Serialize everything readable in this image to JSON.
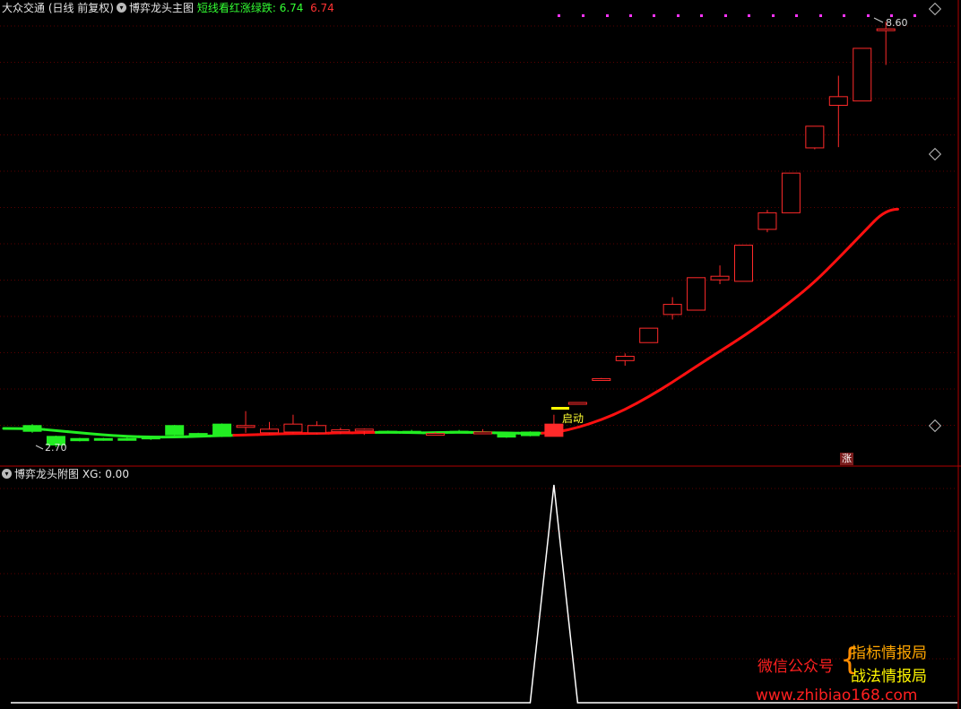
{
  "header": {
    "stock": "大众交通 (日线 前复权)",
    "indicator": "博弈龙头主图",
    "legend_label": "短线看红涨绿跌:",
    "legend_val1": "6.74",
    "legend_val2": "6.74"
  },
  "subheader": {
    "indicator": "博弈龙头附图",
    "xg_label": "XG:",
    "xg_value": "0.00"
  },
  "annotations": {
    "start_label": "启动",
    "high_label": "8.60",
    "low_label": "2.70",
    "zhang": "涨"
  },
  "watermark": {
    "public": "微信公众号",
    "brace": "{",
    "line1": "指标情报局",
    "line2": "战法情报局",
    "url": "www.zhibiao168.com"
  },
  "colors": {
    "bg": "#000000",
    "up": "#ff2a2a",
    "down": "#22ee22",
    "ma_red": "#ff1010",
    "ma_green": "#22ee22",
    "grid": "#5a0000",
    "xg_line": "#ffffff",
    "marker": "#ffff00",
    "dot": "#ff33ff"
  },
  "chart_data": [
    {
      "type": "candlestick",
      "title": "博弈龙头主图",
      "ylim": [
        2.5,
        8.9
      ],
      "series": [
        {
          "o": 3.0,
          "h": 3.02,
          "l": 2.9,
          "c": 2.92,
          "color": "down"
        },
        {
          "o": 2.85,
          "h": 2.86,
          "l": 2.7,
          "c": 2.73,
          "color": "down"
        },
        {
          "o": 2.82,
          "h": 2.83,
          "l": 2.78,
          "c": 2.79,
          "color": "down"
        },
        {
          "o": 2.81,
          "h": 2.83,
          "l": 2.79,
          "c": 2.82,
          "color": "down"
        },
        {
          "o": 2.82,
          "h": 2.84,
          "l": 2.79,
          "c": 2.8,
          "color": "down"
        },
        {
          "o": 2.83,
          "h": 2.85,
          "l": 2.8,
          "c": 2.84,
          "color": "down"
        },
        {
          "o": 3.0,
          "h": 3.01,
          "l": 2.86,
          "c": 2.87,
          "color": "down"
        },
        {
          "o": 2.88,
          "h": 2.9,
          "l": 2.86,
          "c": 2.89,
          "color": "down"
        },
        {
          "o": 3.02,
          "h": 3.03,
          "l": 2.84,
          "c": 2.85,
          "color": "down"
        },
        {
          "o": 2.98,
          "h": 3.2,
          "l": 2.9,
          "c": 3.0,
          "color": "up"
        },
        {
          "o": 2.9,
          "h": 3.05,
          "l": 2.88,
          "c": 2.95,
          "color": "up"
        },
        {
          "o": 2.91,
          "h": 3.15,
          "l": 2.89,
          "c": 3.02,
          "color": "up"
        },
        {
          "o": 2.9,
          "h": 3.06,
          "l": 2.88,
          "c": 3.0,
          "color": "up"
        },
        {
          "o": 2.94,
          "h": 2.97,
          "l": 2.88,
          "c": 2.92,
          "color": "up"
        },
        {
          "o": 2.93,
          "h": 2.96,
          "l": 2.87,
          "c": 2.95,
          "color": "up"
        },
        {
          "o": 2.91,
          "h": 2.93,
          "l": 2.9,
          "c": 2.92,
          "color": "down"
        },
        {
          "o": 2.92,
          "h": 2.94,
          "l": 2.9,
          "c": 2.91,
          "color": "down"
        },
        {
          "o": 2.88,
          "h": 2.91,
          "l": 2.87,
          "c": 2.89,
          "color": "up"
        },
        {
          "o": 2.92,
          "h": 2.94,
          "l": 2.9,
          "c": 2.91,
          "color": "down"
        },
        {
          "o": 2.9,
          "h": 2.95,
          "l": 2.89,
          "c": 2.91,
          "color": "up"
        },
        {
          "o": 2.89,
          "h": 2.91,
          "l": 2.83,
          "c": 2.84,
          "color": "down"
        },
        {
          "o": 2.91,
          "h": 2.92,
          "l": 2.85,
          "c": 2.86,
          "color": "down"
        },
        {
          "o": 2.85,
          "h": 3.15,
          "l": 2.85,
          "c": 3.02,
          "color": "up"
        },
        {
          "o": 3.32,
          "h": 3.32,
          "l": 3.32,
          "c": 3.32,
          "color": "up"
        },
        {
          "o": 3.65,
          "h": 3.66,
          "l": 3.65,
          "c": 3.65,
          "color": "up"
        },
        {
          "o": 3.9,
          "h": 4.0,
          "l": 3.83,
          "c": 3.96,
          "color": "up"
        },
        {
          "o": 4.15,
          "h": 4.35,
          "l": 4.15,
          "c": 4.35,
          "color": "up"
        },
        {
          "o": 4.54,
          "h": 4.78,
          "l": 4.47,
          "c": 4.68,
          "color": "up"
        },
        {
          "o": 4.6,
          "h": 5.05,
          "l": 4.6,
          "c": 5.05,
          "color": "up"
        },
        {
          "o": 5.02,
          "h": 5.22,
          "l": 4.96,
          "c": 5.07,
          "color": "up"
        },
        {
          "o": 5.0,
          "h": 5.5,
          "l": 5.0,
          "c": 5.5,
          "color": "up"
        },
        {
          "o": 5.72,
          "h": 5.99,
          "l": 5.68,
          "c": 5.95,
          "color": "up"
        },
        {
          "o": 5.95,
          "h": 6.5,
          "l": 5.95,
          "c": 6.5,
          "color": "up"
        },
        {
          "o": 6.85,
          "h": 7.15,
          "l": 6.83,
          "c": 7.15,
          "color": "up"
        },
        {
          "o": 7.44,
          "h": 7.85,
          "l": 6.86,
          "c": 7.56,
          "color": "up"
        },
        {
          "o": 7.5,
          "h": 8.23,
          "l": 7.5,
          "c": 8.23,
          "color": "up"
        },
        {
          "o": 8.5,
          "h": 8.6,
          "l": 8.0,
          "c": 8.5,
          "color": "up"
        }
      ],
      "ma": [
        2.96,
        2.93,
        2.9,
        2.87,
        2.85,
        2.84,
        2.84,
        2.85,
        2.86,
        2.87,
        2.88,
        2.89,
        2.89,
        2.9,
        2.9,
        2.91,
        2.9,
        2.9,
        2.91,
        2.9,
        2.9,
        2.89,
        2.9,
        2.97,
        3.08,
        3.22,
        3.4,
        3.6,
        3.82,
        4.03,
        4.24,
        4.47,
        4.72,
        4.99,
        5.32,
        5.66,
        6.0
      ],
      "ma_color": [
        "down",
        "down",
        "down",
        "down",
        "down",
        "down",
        "down",
        "down",
        "down",
        "up",
        "up",
        "up",
        "up",
        "up",
        "up",
        "down",
        "down",
        "down",
        "down",
        "down",
        "down",
        "down",
        "up",
        "up",
        "up",
        "up",
        "up",
        "up",
        "up",
        "up",
        "up",
        "up",
        "up",
        "up",
        "up",
        "up",
        "up"
      ],
      "start_signal_index": 22,
      "annotations": [
        "启动",
        "8.60",
        "2.70",
        "涨"
      ]
    },
    {
      "type": "line",
      "title": "博弈龙头附图",
      "name": "XG",
      "ylim": [
        0,
        1
      ],
      "values": [
        0,
        0,
        0,
        0,
        0,
        0,
        0,
        0,
        0,
        0,
        0,
        0,
        0,
        0,
        0,
        0,
        0,
        0,
        0,
        0,
        0,
        0,
        1,
        0,
        0,
        0,
        0,
        0,
        0,
        0,
        0,
        0,
        0,
        0,
        0,
        0,
        0
      ]
    }
  ]
}
